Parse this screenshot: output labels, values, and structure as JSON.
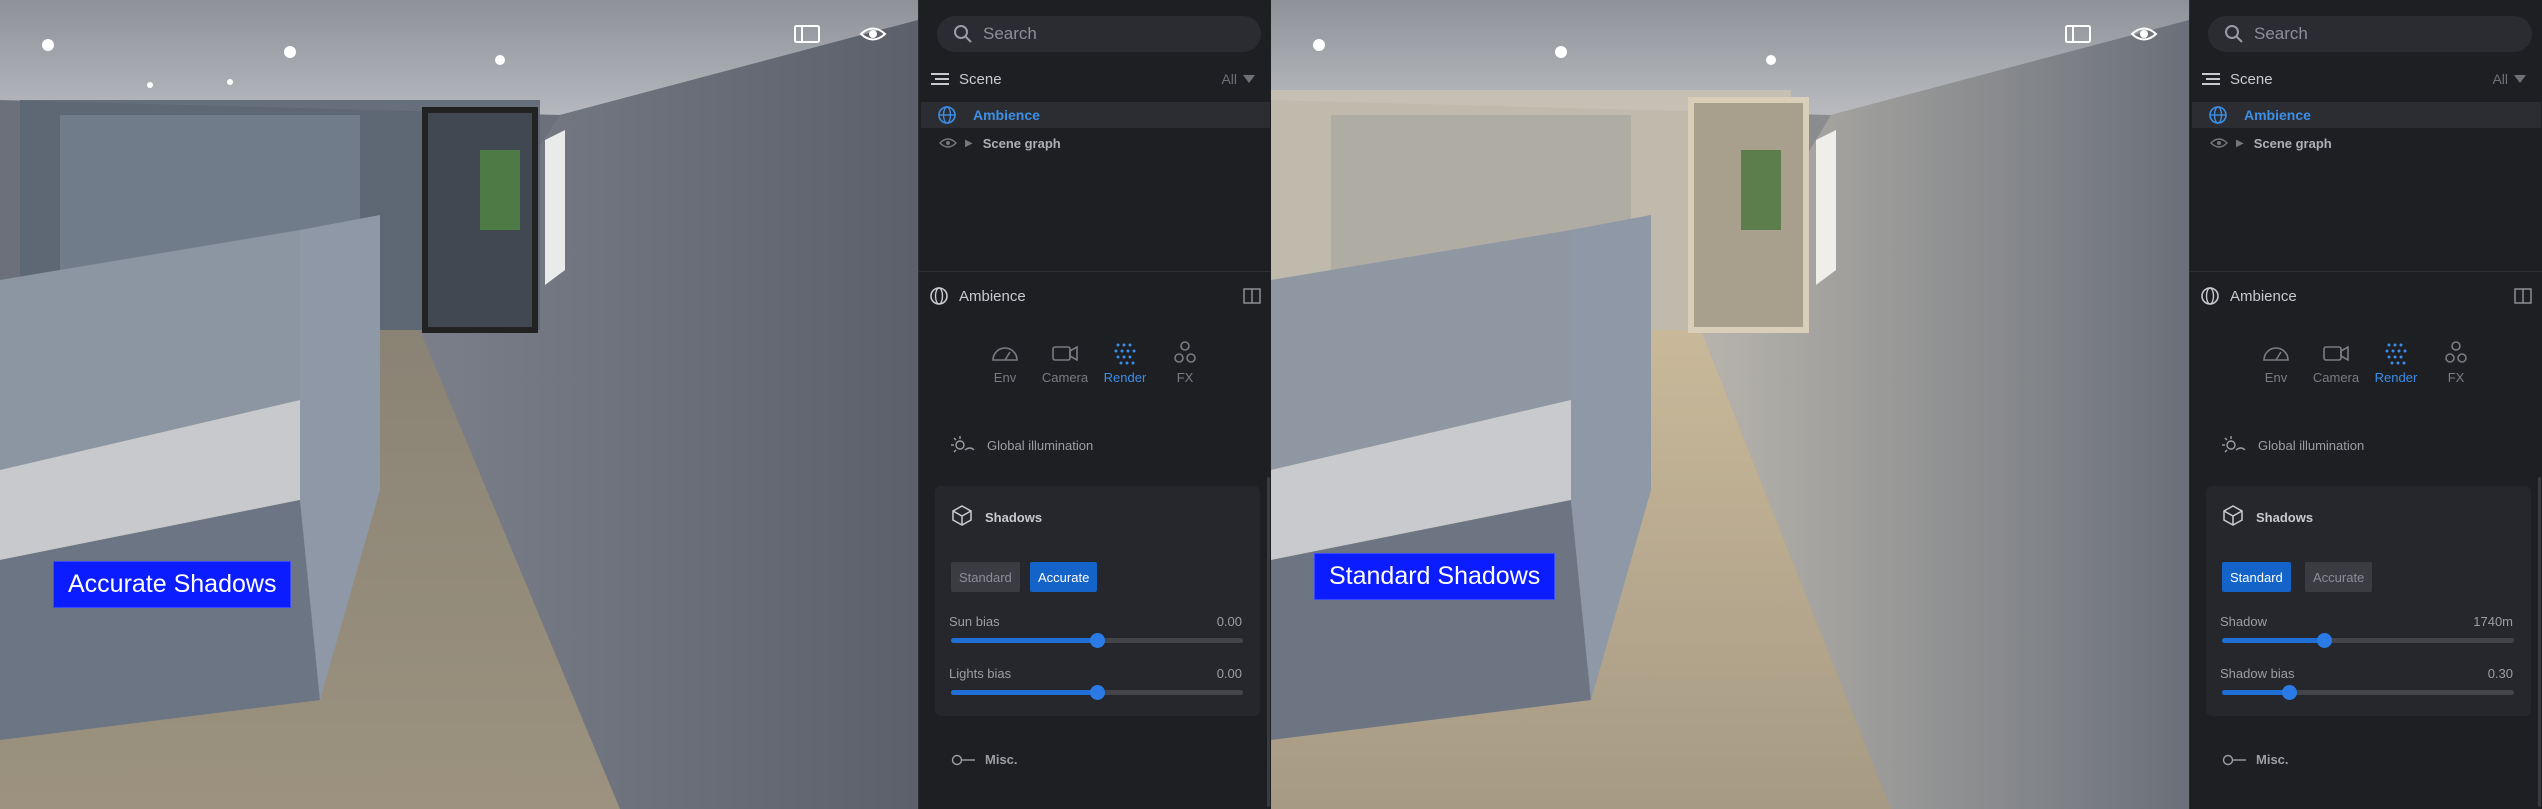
{
  "panels": [
    {
      "caption": "Accurate Shadows",
      "search_placeholder": "Search",
      "scene_title": "Scene",
      "filter_label": "All",
      "tree": [
        {
          "label": "Ambience",
          "icon": "globe-icon",
          "selected": true
        },
        {
          "label": "Scene graph",
          "icon": "eye-icon",
          "selected": false
        }
      ],
      "props_title": "Ambience",
      "tabs": [
        {
          "label": "Env",
          "icon": "gauge-icon"
        },
        {
          "label": "Camera",
          "icon": "camera-icon"
        },
        {
          "label": "Render",
          "icon": "dots-grid-icon",
          "active": true
        },
        {
          "label": "FX",
          "icon": "fx-icon"
        }
      ],
      "global_illumination_label": "Global illumination",
      "shadows_title": "Shadows",
      "mode_options": [
        "Standard",
        "Accurate"
      ],
      "selected_mode": "Accurate",
      "sliders": [
        {
          "label": "Sun bias",
          "value": "0.00",
          "fraction": 0.5
        },
        {
          "label": "Lights bias",
          "value": "0.00",
          "fraction": 0.5
        }
      ],
      "misc_label": "Misc."
    },
    {
      "caption": "Standard Shadows",
      "search_placeholder": "Search",
      "scene_title": "Scene",
      "filter_label": "All",
      "tree": [
        {
          "label": "Ambience",
          "icon": "globe-icon",
          "selected": true
        },
        {
          "label": "Scene graph",
          "icon": "eye-icon",
          "selected": false
        }
      ],
      "props_title": "Ambience",
      "tabs": [
        {
          "label": "Env",
          "icon": "gauge-icon"
        },
        {
          "label": "Camera",
          "icon": "camera-icon"
        },
        {
          "label": "Render",
          "icon": "dots-grid-icon",
          "active": true
        },
        {
          "label": "FX",
          "icon": "fx-icon"
        }
      ],
      "global_illumination_label": "Global illumination",
      "shadows_title": "Shadows",
      "mode_options": [
        "Standard",
        "Accurate"
      ],
      "selected_mode": "Standard",
      "sliders": [
        {
          "label": "Shadow",
          "value": "1740m",
          "fraction": 0.35
        },
        {
          "label": "Shadow bias",
          "value": "0.30",
          "fraction": 0.23
        }
      ],
      "misc_label": "Misc."
    }
  ],
  "colors": {
    "accent": "#1463c8",
    "caption_bg": "#0b1cff",
    "panel_bg": "#1e1f23"
  }
}
